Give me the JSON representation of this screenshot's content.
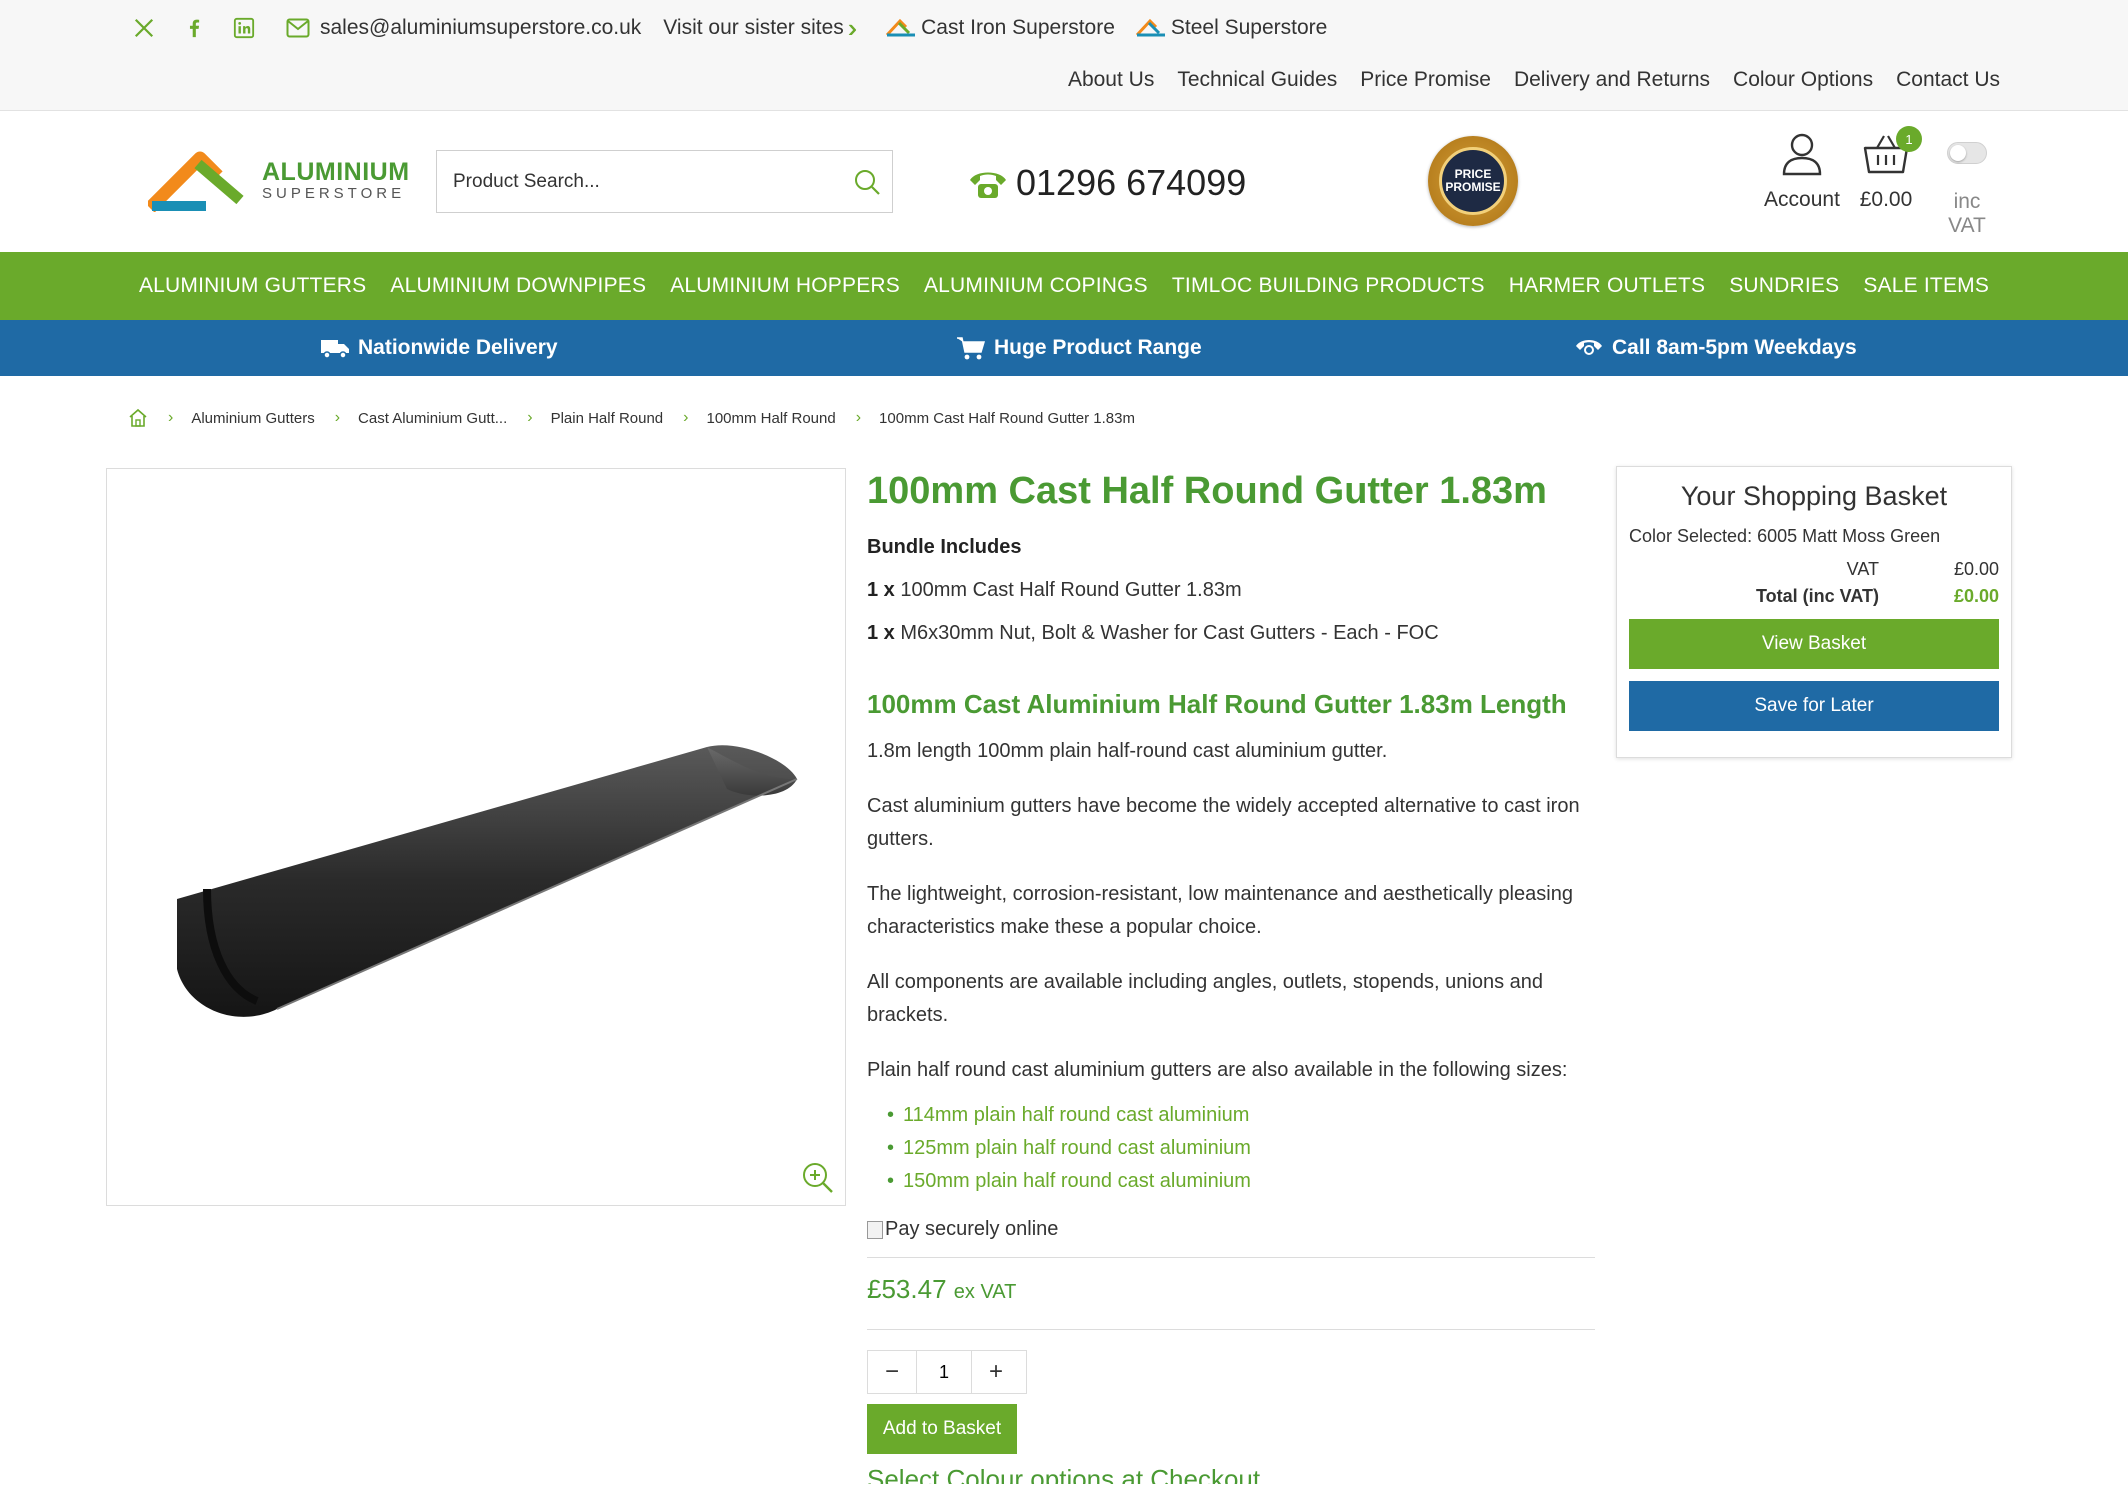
{
  "topbar": {
    "email": "sales@aluminiumsuperstore.co.uk",
    "sister_label": "Visit our sister sites",
    "sister_sites": [
      "Cast Iron Superstore",
      "Steel Superstore"
    ],
    "links": [
      "About Us",
      "Technical Guides",
      "Price Promise",
      "Delivery and Returns",
      "Colour Options",
      "Contact Us"
    ]
  },
  "header": {
    "logo_main": "ALUMINIUM",
    "logo_sub": "SUPERSTORE",
    "search_placeholder": "Product Search...",
    "phone": "01296 674099",
    "badge_line1": "PRICE",
    "badge_line2": "PROMISE",
    "account_label": "Account",
    "basket_total": "£0.00",
    "basket_count": "1",
    "vat_label": "inc VAT"
  },
  "nav": [
    "ALUMINIUM GUTTERS",
    "ALUMINIUM DOWNPIPES",
    "ALUMINIUM HOPPERS",
    "ALUMINIUM COPINGS",
    "TIMLOC BUILDING PRODUCTS",
    "HARMER OUTLETS",
    "SUNDRIES",
    "SALE ITEMS"
  ],
  "strip": [
    "Nationwide Delivery",
    "Huge Product Range",
    "Call 8am-5pm Weekdays"
  ],
  "breadcrumb": [
    "Aluminium Gutters",
    "Cast Aluminium Gutt...",
    "Plain Half Round",
    "100mm Half Round",
    "100mm Cast Half Round Gutter 1.83m"
  ],
  "product": {
    "title": "100mm Cast Half Round Gutter 1.83m",
    "bundle_heading": "Bundle Includes",
    "bundle": [
      {
        "qty": "1 x",
        "name": "100mm Cast Half Round Gutter 1.83m"
      },
      {
        "qty": "1 x",
        "name": "M6x30mm Nut, Bolt & Washer for Cast Gutters - Each - FOC"
      }
    ],
    "subheading": "100mm Cast Aluminium Half Round Gutter 1.83m Length",
    "paragraphs": [
      "1.8m length 100mm plain half-round cast aluminium gutter.",
      "Cast aluminium gutters have become the widely accepted alternative to cast iron gutters.",
      "The lightweight, corrosion-resistant, low maintenance and aesthetically pleasing characteristics make these a popular choice.",
      "All components are available including angles, outlets, stopends, unions and brackets.",
      "Plain half round cast aluminium gutters are also available in the following sizes:"
    ],
    "sizes": [
      "114mm plain half round cast aluminium",
      "125mm plain half round cast aluminium",
      "150mm plain half round cast aluminium"
    ],
    "pay_alt": "Pay securely online",
    "price": "£53.47",
    "price_suffix": "ex VAT",
    "quantity": "1",
    "add_label": "Add to Basket",
    "colour_link": "Select Colour options at Checkout"
  },
  "basket": {
    "title": "Your Shopping Basket",
    "color_selected": "Color Selected: 6005 Matt Moss Green",
    "vat_label": "VAT",
    "vat_value": "£0.00",
    "total_label": "Total (inc VAT)",
    "total_value": "£0.00",
    "view_label": "View Basket",
    "save_label": "Save for Later"
  },
  "colors": {
    "brand_green": "#6aaa2b",
    "brand_blue": "#1f6aa5",
    "title_green": "#4a9a33"
  }
}
